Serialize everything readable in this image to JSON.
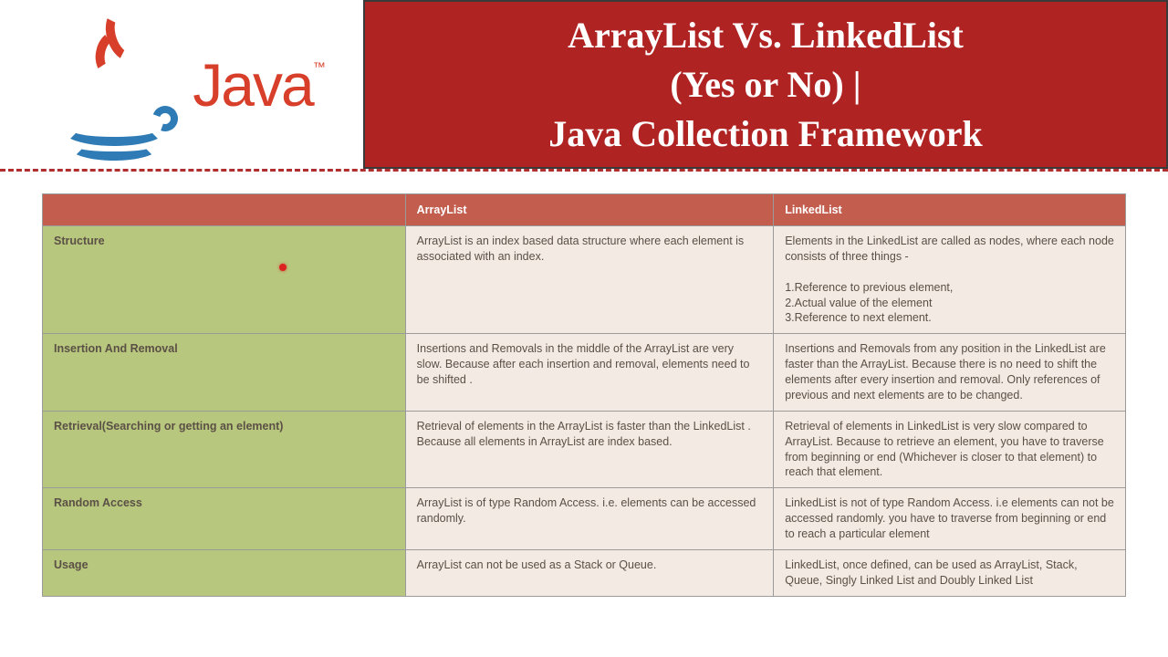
{
  "header": {
    "logo_text": "Java",
    "trademark": "™",
    "title_line1": "ArrayList Vs. LinkedList",
    "title_line2": "(Yes or No)   |",
    "title_line3": "Java Collection Framework"
  },
  "table": {
    "headers": [
      "",
      "ArrayList",
      "LinkedList"
    ],
    "rows": [
      {
        "label": "Structure",
        "arraylist": "ArrayList is an index based data structure where each element is associated with an index.",
        "linkedlist": "Elements in the LinkedList are called as nodes, where each node consists of three things  -\n\n1.Reference to previous element,\n2.Actual value of the element\n3.Reference to next element."
      },
      {
        "label": "Insertion And Removal",
        "arraylist": "Insertions and Removals in the middle of the ArrayList are very slow. Because after each insertion and removal, elements need to be shifted .",
        "linkedlist": "Insertions and Removals from any position in the LinkedList are faster than the ArrayList. Because there is no need to shift the elements after every insertion and removal. Only references of previous and next elements are to be changed."
      },
      {
        "label": "Retrieval(Searching or getting an element)",
        "arraylist": "Retrieval of elements in the ArrayList is faster than the LinkedList . Because all elements in ArrayList are index based.",
        "linkedlist": "Retrieval of elements in LinkedList is very slow compared to ArrayList. Because to retrieve an element, you have to traverse from beginning or end (Whichever is closer to that element) to reach that element."
      },
      {
        "label": "Random Access",
        "arraylist": "ArrayList is of type Random Access. i.e. elements can be accessed randomly.",
        "linkedlist": "LinkedList is not of type Random Access. i.e elements can not be accessed randomly. you have to traverse from beginning or end to reach a particular element"
      },
      {
        "label": "Usage",
        "arraylist": "ArrayList can not be used as a Stack or Queue.",
        "linkedlist": "LinkedList, once defined, can be used as ArrayList, Stack, Queue, Singly Linked List and Doubly Linked List"
      }
    ]
  }
}
